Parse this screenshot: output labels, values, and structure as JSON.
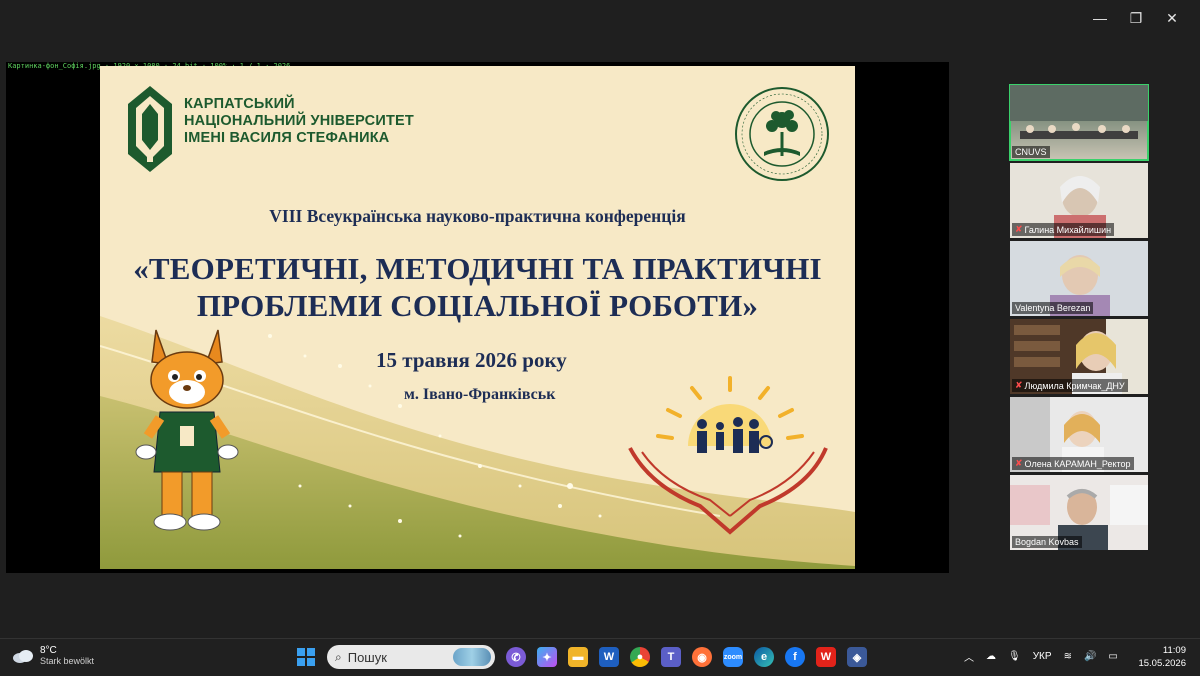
{
  "window": {
    "minimize": "—",
    "restore": "❐",
    "close": "✕"
  },
  "share": {
    "caption": "Картинка-фон_Софія.jpg   ·   1920 × 1080 · 24 bit · 100% · 1 / 1 · 2026",
    "slide": {
      "uni_lines": [
        "КАРПАТСЬКИЙ",
        "НАЦІОНАЛЬНИЙ УНІВЕРСИТЕТ",
        "ІМЕНІ ВАСИЛЯ СТЕФАНИКА"
      ],
      "conference": "VIII Всеукраїнська науково-практична конференція",
      "title_lines": [
        "«ТЕОРЕТИЧНІ, МЕТОДИЧНІ ТА ПРАКТИЧНІ",
        "ПРОБЛЕМИ СОЦІАЛЬНОЇ РОБОТИ»"
      ],
      "date": "15  травня 2026 року",
      "city": "м. Івано-Франківськ",
      "colors": {
        "green": "#1d5a2e",
        "navy": "#1d2d55",
        "bg": "#f7e9c6",
        "accent": "#c0392b"
      }
    }
  },
  "participants": [
    {
      "name": "CNUVS",
      "muted": false,
      "active": true
    },
    {
      "name": "Галина Михайлишин",
      "muted": true,
      "active": false
    },
    {
      "name": "Valentyna Berezan",
      "muted": false,
      "active": false
    },
    {
      "name": "Людмила Кримчак_ДНУ",
      "muted": true,
      "active": false
    },
    {
      "name": "Олена КАРАМАН_Ректор",
      "muted": true,
      "active": false
    },
    {
      "name": "Bogdan Kovbas",
      "muted": false,
      "active": false
    }
  ],
  "taskbar": {
    "weather_temp": "8°C",
    "weather_text": "Stark bewölkt",
    "search_placeholder": "Пошук",
    "lang": "УКР",
    "time": "11:09",
    "date": "15.05.2026"
  }
}
